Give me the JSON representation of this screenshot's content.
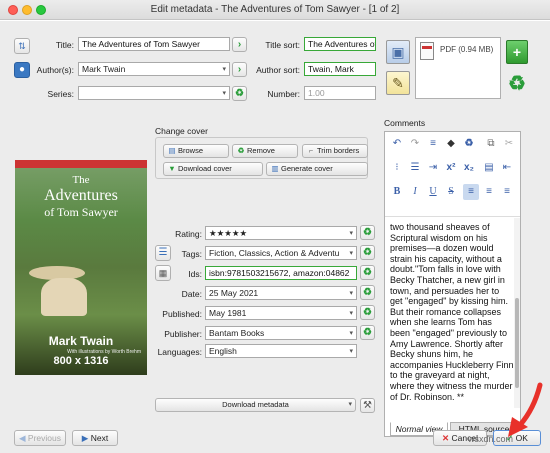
{
  "window": {
    "title": "Edit metadata - The Adventures of Tom Sawyer -  [1 of 2]"
  },
  "fields": {
    "title_label": "Title:",
    "title_value": "The Adventures of Tom Sawyer",
    "title_sort_label": "Title sort:",
    "title_sort_value": "The Adventures of To",
    "authors_label": "Author(s):",
    "authors_value": "Mark Twain",
    "author_sort_label": "Author sort:",
    "author_sort_value": "Twain, Mark",
    "series_label": "Series:",
    "series_value": "",
    "number_label": "Number:",
    "number_value": "1.00"
  },
  "formats": {
    "item_label": "PDF (0.94 MB)"
  },
  "cover": {
    "section_label": "Change cover",
    "browse": "Browse",
    "remove": "Remove",
    "trim": "Trim borders",
    "download": "Download cover",
    "generate": "Generate cover",
    "image": {
      "line1": "The",
      "line2": "Adventures",
      "line3": "of Tom Sawyer",
      "author": "Mark Twain",
      "illustrator": "With illustrations by Worth Brehm",
      "dimensions": "800 x 1316"
    }
  },
  "meta": {
    "rating_label": "Rating:",
    "rating_value": "★★★★★",
    "tags_label": "Tags:",
    "tags_value": "Fiction, Classics, Action & Adventu",
    "ids_label": "Ids:",
    "ids_value": "isbn:9781503215672, amazon:04862",
    "date_label": "Date:",
    "date_value": "25 May 2021",
    "published_label": "Published:",
    "published_value": "May 1981",
    "publisher_label": "Publisher:",
    "publisher_value": "Bantam Books",
    "languages_label": "Languages:",
    "languages_value": "English",
    "download_metadata": "Download metadata"
  },
  "comments": {
    "label": "Comments",
    "text": "two thousand sheaves of Scriptural wisdom on his premises—a dozen would strain his capacity, without a doubt.\"Tom falls in love with Becky Thatcher, a new girl in town, and persuades her to get \"engaged\" by kissing him. But their romance collapses when she learns Tom has been \"engaged\" previously to Amy Lawrence. Shortly after Becky shuns him, he accompanies Huckleberry Finn to the graveyard at night, where they witness the murder of Dr. Robinson. **",
    "tab_normal": "Normal view",
    "tab_html": "HTML source"
  },
  "footer": {
    "previous": "Previous",
    "next": "Next",
    "cancel": "Cancel",
    "ok": "OK"
  },
  "watermark": "wsxdn.com",
  "colors": {
    "accent_green": "#2a9d3a",
    "arrow_red": "#e8312a"
  }
}
